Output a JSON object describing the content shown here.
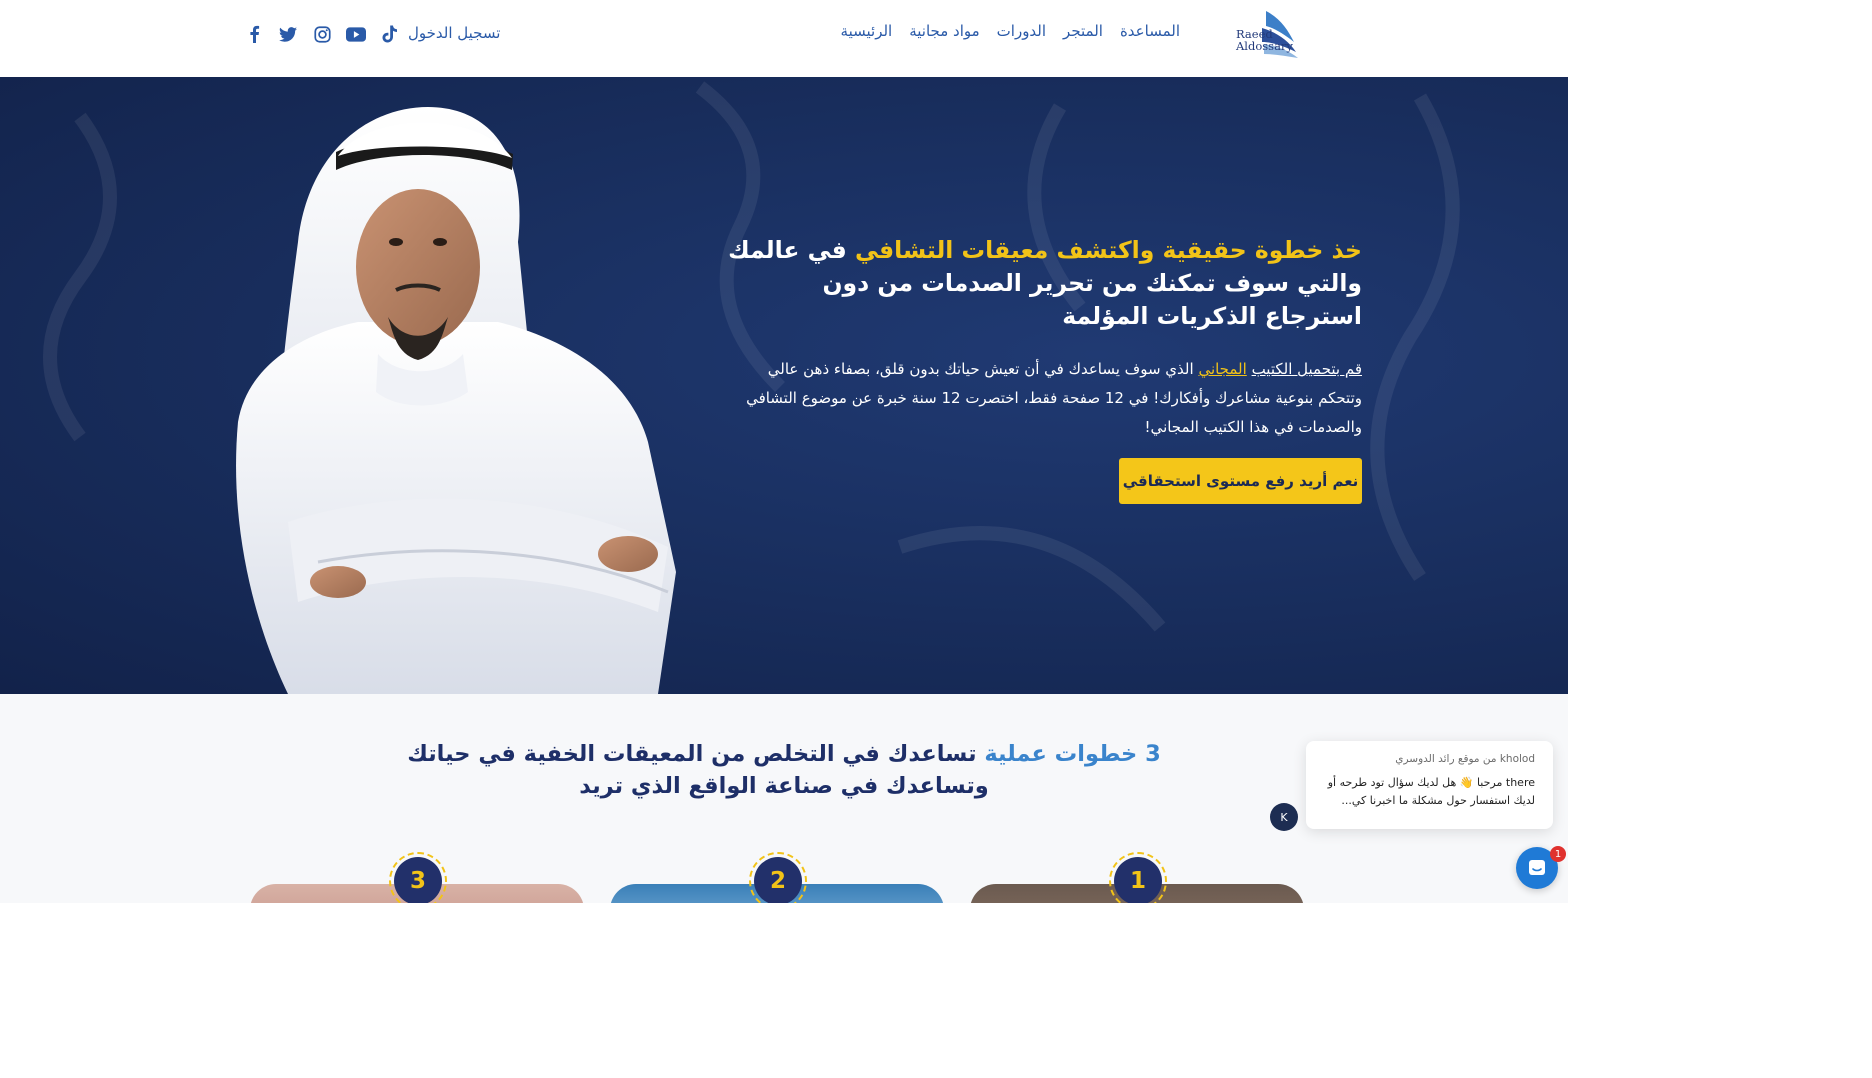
{
  "header": {
    "logo": {
      "line1": "Raeed",
      "line2": "Aldossary"
    },
    "nav": [
      "الرئيسية",
      "مواد مجانية",
      "الدورات",
      "المتجر",
      "المساعدة"
    ],
    "login_label": "تسجيل الدخول",
    "social_icons": [
      "tiktok-icon",
      "youtube-icon",
      "instagram-icon",
      "twitter-icon",
      "facebook-icon"
    ]
  },
  "hero": {
    "title_highlight": "خذ خطوة حقيقية واكتشف معيقات التشافي",
    "title_rest_line1": " في عالمك",
    "title_line2": "والتي سوف تمكنك من تحرير الصدمات من دون",
    "title_line3": "استرجاع الذكريات المؤلمة",
    "body_link": "قم بتحميل الكتيب",
    "body_link_highlight": "المجاني",
    "body_text": " الذي سوف يساعدك في أن تعيش حياتك بدون قلق، بصفاء ذهن عالي وتتحكم بنوعية مشاعرك وأفكارك! في 12 صفحة فقط، اختصرت 12 سنة خبرة عن موضوع التشافي والصدمات في هذا الكتيب المجاني!",
    "cta_label": "نعم أريد رفع مستوى استحقاقي"
  },
  "steps": {
    "title_highlight": "3 خطوات عملية",
    "title_rest": " تساعدك في التخلص من المعيقات الخفية في حياتك وتساعدك في صناعة الواقع الذي تريد",
    "badges": [
      "1",
      "2",
      "3"
    ]
  },
  "chat": {
    "from": "kholod من موقع رائد الدوسري",
    "message": "there مرحبا 👋 هل لديك سؤال تود طرحه أو لديك استفسار حول مشكلة ما اخبرنا كي...",
    "avatar_initial": "K",
    "unread_count": "1"
  },
  "colors": {
    "accent_yellow": "#f2c318",
    "navy": "#182d5c",
    "link_blue": "#2a5aa8",
    "chat_blue": "#1f7ad6"
  }
}
